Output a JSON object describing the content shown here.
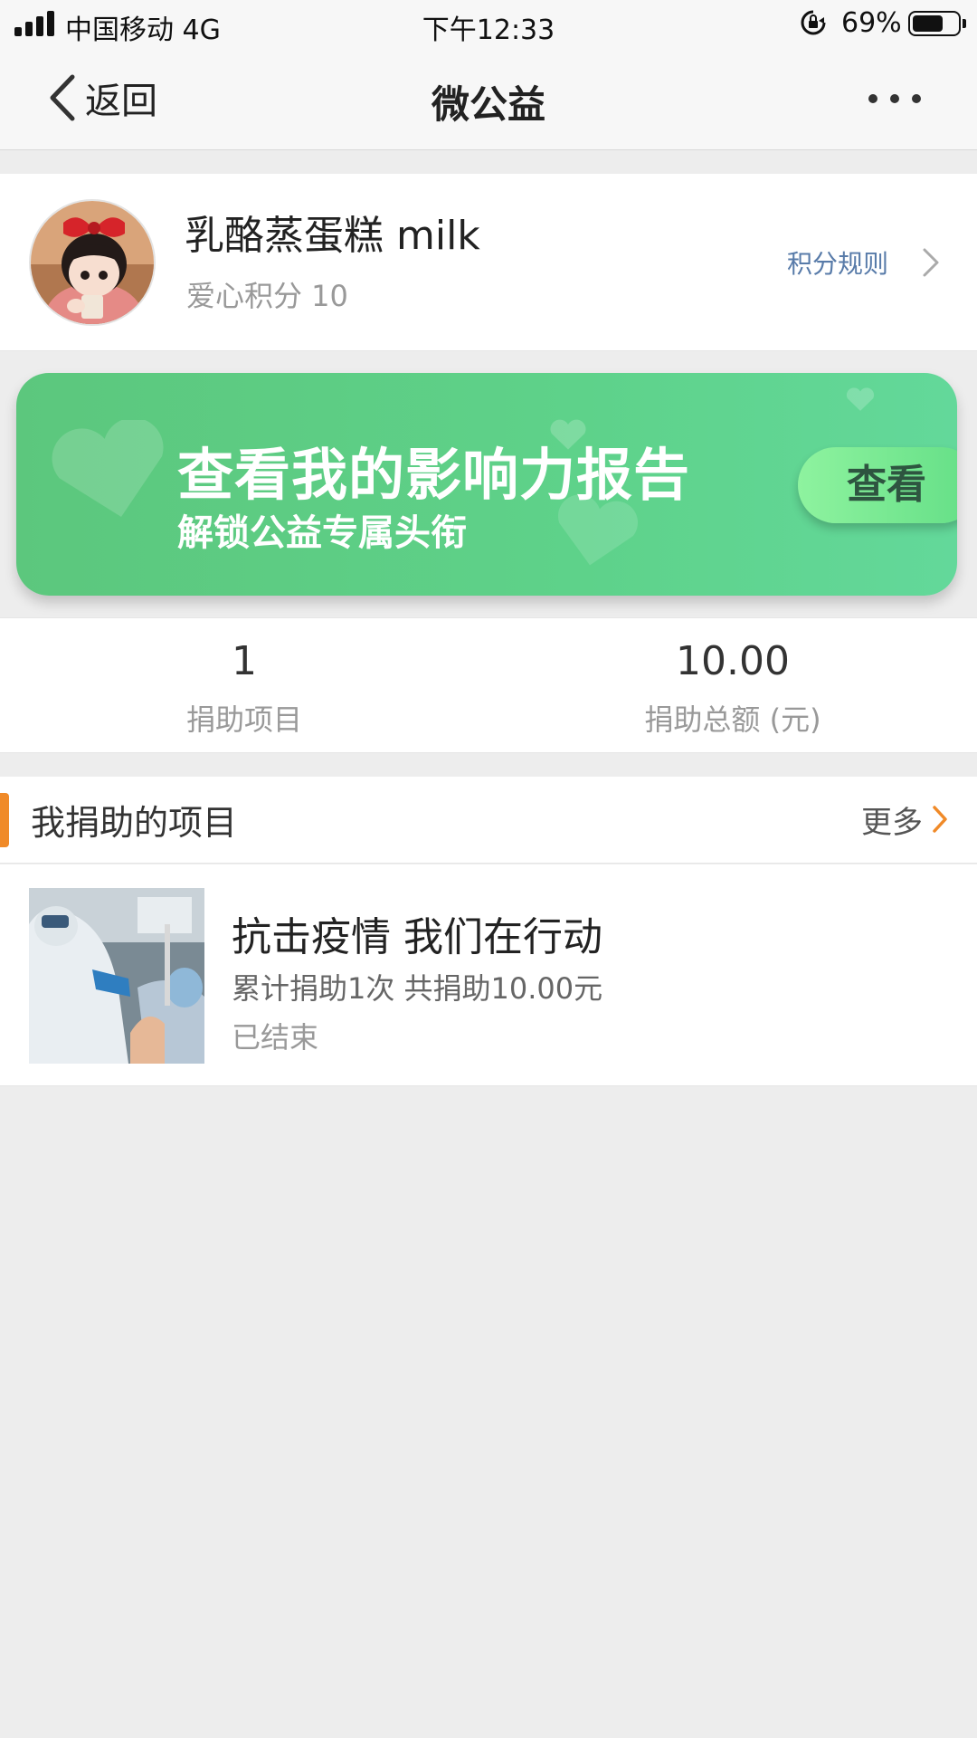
{
  "status_bar": {
    "carrier": "中国移动 4G",
    "time": "下午12:33",
    "battery_percent": "69%",
    "battery_level": 0.69
  },
  "nav": {
    "back_label": "返回",
    "title": "微公益"
  },
  "profile": {
    "nickname": "乳酪蒸蛋糕 milk",
    "points": "爱心积分 10",
    "rules_label": "积分规则"
  },
  "banner": {
    "title": "查看我的影响力报告",
    "subtitle": "解锁公益专属头衔",
    "button_label": "查看"
  },
  "stats": [
    {
      "value": "1",
      "label": "捐助项目"
    },
    {
      "value": "10.00",
      "label": "捐助总额 (元)"
    }
  ],
  "section": {
    "title": "我捐助的项目",
    "more_label": "更多"
  },
  "projects": [
    {
      "title": "抗击疫情 我们在行动",
      "meta": "累计捐助1次 共捐助10.00元",
      "status": "已结束"
    }
  ],
  "colors": {
    "accent": "#f08a28",
    "link": "#587ba9",
    "banner_green": "#5ecd87"
  }
}
